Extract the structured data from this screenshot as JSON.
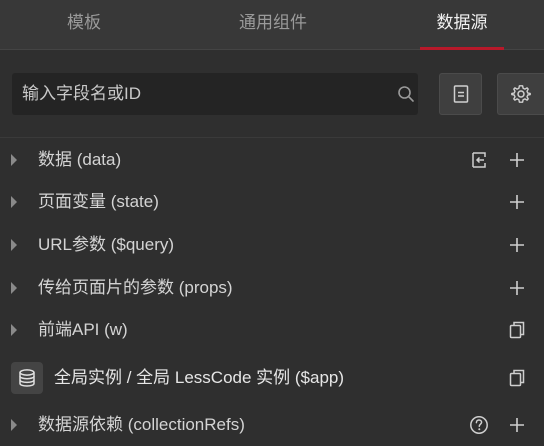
{
  "tabs": [
    {
      "label": "模板",
      "active": false
    },
    {
      "label": "通用组件",
      "active": false
    },
    {
      "label": "数据源",
      "active": true
    }
  ],
  "search": {
    "placeholder": "输入字段名或ID",
    "value": ""
  },
  "toolbar": {
    "doc_icon": "document-icon",
    "settings_icon": "gear-icon"
  },
  "tree": [
    {
      "label": "数据 (data)",
      "icons": [
        "collapse-left-icon",
        "plus-icon"
      ]
    },
    {
      "label": "页面变量 (state)",
      "icons": [
        "plus-icon"
      ]
    },
    {
      "label": "URL参数 ($query)",
      "icons": [
        "plus-icon"
      ]
    },
    {
      "label": "传给页面片的参数 (props)",
      "icons": [
        "plus-icon"
      ]
    },
    {
      "label": "前端API (w)",
      "icons": [
        "copy-icon"
      ]
    },
    {
      "label": "全局实例 / 全局 LessCode 实例 ($app)",
      "icons": [
        "copy-icon"
      ]
    },
    {
      "label": "数据源依赖 (collectionRefs)",
      "icons": [
        "help-icon",
        "plus-icon"
      ]
    }
  ],
  "colors": {
    "accent": "#b8192a",
    "background": "#2f2f2f",
    "tab_bar": "#383838"
  }
}
